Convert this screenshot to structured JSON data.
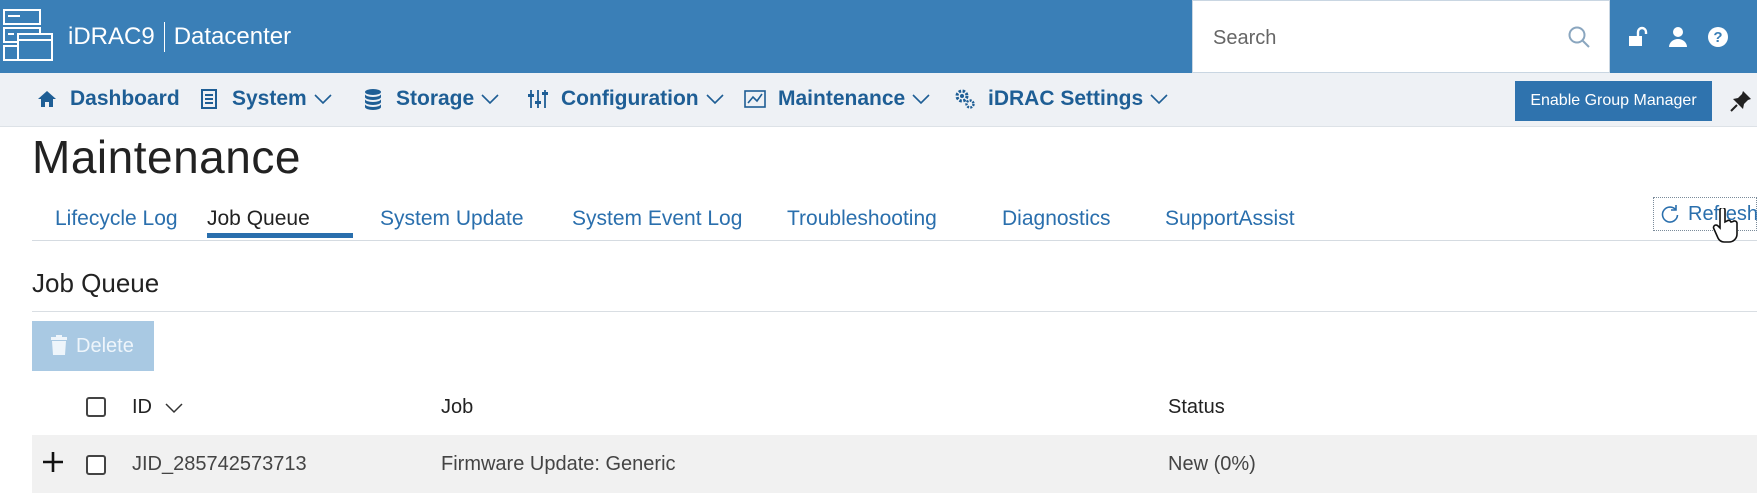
{
  "header": {
    "product": "iDRAC9",
    "edition": "Datacenter",
    "search_placeholder": "Search",
    "accent_color": "#3a7fb7"
  },
  "nav": {
    "items": [
      {
        "label": "Dashboard",
        "icon": "home-icon"
      },
      {
        "label": "System",
        "icon": "server-icon"
      },
      {
        "label": "Storage",
        "icon": "database-icon"
      },
      {
        "label": "Configuration",
        "icon": "sliders-icon"
      },
      {
        "label": "Maintenance",
        "icon": "chart-icon"
      },
      {
        "label": "iDRAC Settings",
        "icon": "gears-icon"
      }
    ],
    "enable_group_manager": "Enable Group Manager"
  },
  "page": {
    "title": "Maintenance",
    "tabs": [
      {
        "label": "Lifecycle Log"
      },
      {
        "label": "Job Queue",
        "active": true
      },
      {
        "label": "System Update"
      },
      {
        "label": "System Event Log"
      },
      {
        "label": "Troubleshooting"
      },
      {
        "label": "Diagnostics"
      },
      {
        "label": "SupportAssist"
      }
    ],
    "refresh_label": "Refresh"
  },
  "job_queue": {
    "title": "Job Queue",
    "delete_label": "Delete",
    "columns": [
      "ID",
      "Job",
      "Status"
    ],
    "rows": [
      {
        "id": "JID_285742573713",
        "job": "Firmware Update: Generic",
        "status": "New (0%)"
      }
    ]
  }
}
